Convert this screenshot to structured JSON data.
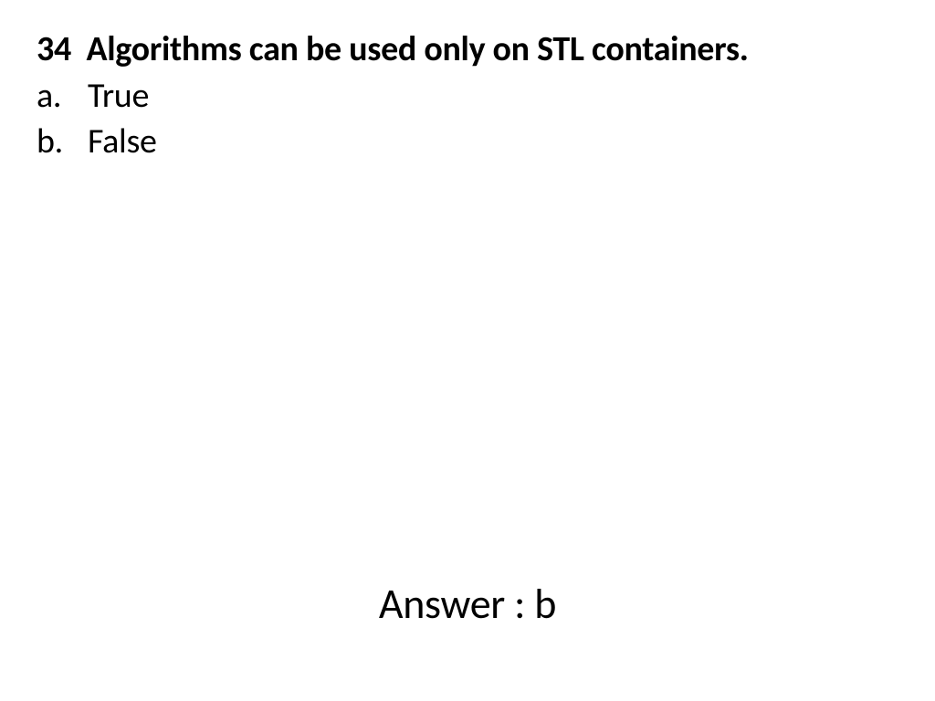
{
  "question": {
    "number": "34",
    "text": "Algorithms can be used only on STL containers.",
    "options": [
      {
        "letter": "a.",
        "text": "True"
      },
      {
        "letter": "b.",
        "text": "False"
      }
    ]
  },
  "answer": {
    "label": "Answer : b"
  }
}
